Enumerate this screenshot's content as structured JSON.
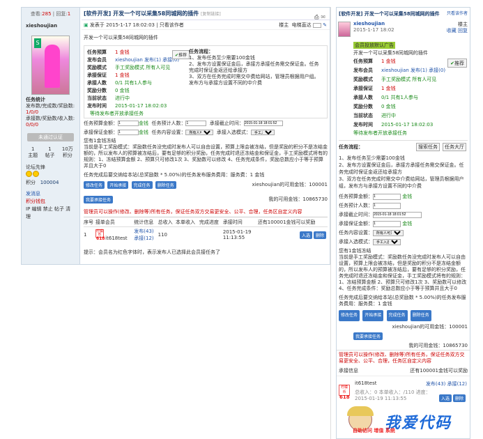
{
  "left": {
    "counts": {
      "views_label": "查看:",
      "views": "285",
      "replies_label": "回复:",
      "replies": "1"
    },
    "title": "[软件开发] 开发一个可以采集58同城网的插件",
    "copy_link": "[复制链接]",
    "meta": {
      "posted": "发表于 2015-1-17 18:02:03",
      "only_author": "只看该作者",
      "floor": "楼主",
      "jump": "电梯直达"
    },
    "username": "xieshoujian",
    "user_info": [
      "任务统计",
      "发布数/完成数/奖励数:",
      "1/0/0",
      "承接数/奖励数/收入数:",
      "0/0/0"
    ],
    "uncertified": "未通过认证",
    "stats": [
      {
        "v": "1",
        "l": "主题"
      },
      {
        "v": "1",
        "l": "帖子"
      },
      {
        "v": "10万",
        "l": "积分"
      }
    ],
    "medal_label": "论坛先锋",
    "points": {
      "label": "积分",
      "value": "100004"
    },
    "links": [
      "发消息",
      "积分钱包",
      "IP 编辑 禁止 帖子 清理"
    ],
    "intro": "开发一个可以采集58同城网的插件",
    "task": {
      "budget_l": "任务预算",
      "budget": "1 金钱",
      "poster_l": "发布会员",
      "poster": "xieshoujian 发布(1) 承接(0)",
      "reward_l": "奖励模式",
      "reward": "手工奖励模式 所有人可见",
      "guarantee_l": "承接保证",
      "guarantee": "1 金钱",
      "takers_l": "承接人数",
      "takers": "0/1 共有1人参与",
      "shares_l": "奖励分数",
      "shares": "0 金钱",
      "status_l": "当前状态",
      "status": "进行中",
      "time_l": "发布时间",
      "time": "2015-01-17 18:02:03",
      "waiting": "等待发布者开放承接任务",
      "recommend": "推荐"
    },
    "flow": {
      "title": "任务流程：",
      "lines": [
        "1、发布任务至少需要100金钱",
        "2、发布方设置保证金后，承接方承接任务需交保证金。任务完成时保证金返还给承接方",
        "3、双方在任务完成时需交中费给网站，管理员根据用户组。发布方与承接方设置不同的中介费"
      ]
    },
    "form": {
      "r1": [
        "任务预算金额：",
        "1",
        "金钱",
        "任务预计人数：",
        "1",
        "承接截止时间：",
        "2015-01-18 18:01:52"
      ],
      "r2": [
        "承接保证金额：",
        "1",
        "金钱",
        "任务内容设置：",
        "所有人可见",
        "承接入选模式：",
        "手工入选"
      ]
    },
    "notes": [
      "您有1金钱冻结",
      "当前是手工奖励模式：奖励数任务没完成时发布人可以自由设置，预算上限会被冻结，但是奖励的积分不是冻结金额的，所以发布人的预算被冻结后，要有足够的积分奖励，任务完成时退还冻结金和保证金，手工奖励模式将有的规则：1、冻结预算金额 2、预算只可修改1次 3、奖励数可以修改 4、任务完成条件，奖励总数应小于等于预算并且大于0"
    ],
    "pay_note": "任务完成后要交纳给本站(总奖励数 * 5.00%)的任务发布服务费用：服务费：1 金钱",
    "buttons": [
      "修改任务",
      "开始承接",
      "完成任务",
      "删除任务"
    ],
    "balance_user": "xieshoujian的可用金钱：100001",
    "accept_btn": "我要承接任务",
    "my_balance": "我的可用金钱：10865730",
    "warning": "管理员可以操作(修改、删除等)所有任务，保证任务双方交易更安全、公平、合理，任务区自定义内容",
    "table": {
      "headers": [
        "序号",
        "接单会员",
        "统计信息",
        "总收入",
        "本单收入",
        "完成进度",
        "承接时间",
        "还有100001金钱可以奖励"
      ],
      "row": {
        "no": "1",
        "uid_a": "柠檬币",
        "uid_b": "618",
        "name": "it618test",
        "stat1": "发布(43)",
        "stat2": "承接(12)",
        "total": "110",
        "this": "",
        "progress": "",
        "time": "2015-01-19 11:13:55",
        "in": "入选",
        "del": "删除"
      }
    },
    "hint": "提示：会员名为红色字体时，表示发布人已选择此会员接任务了"
  },
  "right": {
    "title": "[软件开发] 开发一个可以采集58同城网的插件",
    "only_author": "只看该作者",
    "floor": "楼主",
    "fav": "收藏",
    "reply": "回复",
    "username": "xieshoujian",
    "date": "2015-1-17 18:02",
    "ad": "会员投放默认广告",
    "intro": "开发一个可以采集58同城网的插件",
    "task": {
      "budget_l": "任务预算",
      "budget": "1 金钱",
      "poster_l": "发布会员",
      "poster": "xieshoujian 发布(1) 承接(0)",
      "reward_l": "奖励模式",
      "reward": "手工奖励模式 所有人可见",
      "guarantee_l": "承接保证",
      "guarantee": "1 金钱",
      "takers_l": "承接人数",
      "takers": "0/1 共有1人参与",
      "shares_l": "奖励分数",
      "shares": "0 金钱",
      "status_l": "当前状态",
      "status": "进行中",
      "time_l": "发布时间",
      "time": "2015-01-17 18:02:03",
      "recommend": "推荐",
      "waiting": "等待发布者开放承接任务"
    },
    "flow_title": "任务流程：",
    "flow_b1": "搜索任务",
    "flow_b2": "任务大厅",
    "flow": [
      "1、发布任务至少需要100金钱",
      "2、发布方设置保证金后，承接方承接任务需交保证金。任务完成时保证金返还给承接方",
      "3、双方在任务完成时需交中介费给网站，管理员根据用户组，发布方与承接方设置不同的中介费"
    ],
    "form": [
      [
        "任务预算金额：",
        "1",
        "金钱"
      ],
      [
        "任务预计人数：",
        "1",
        ""
      ],
      [
        "承接截止时间：",
        "2015-01-18 18:01:52",
        ""
      ],
      [
        "承接保证金额：",
        "1",
        "金钱"
      ],
      [
        "任务内容设置：",
        "所有人可见",
        ""
      ],
      [
        "承接入选模式：",
        "手工入选",
        ""
      ]
    ],
    "notes": [
      "您有1金钱冻结",
      "当前是手工奖励模式：奖励数任务没完成时发布人可以自由设置，预算上限会被冻结，但是奖励的积分不是冻结金额的，所以发布人的预算被冻结后，要有足够的积分奖励，任务完成时退还冻结金和保证金，手工奖励模式将有的规则：1、冻结预算金额 2、预算只可修改1次 3、奖励数可以修改 4、任务完成条件：奖励总数应小于等于预算并且大于0"
    ],
    "pay_note": "任务完成后要交纳给本站(总奖励数 * 5.00%)的任务发布服务费用：服务费：1 金钱",
    "buttons": [
      "修改任务",
      "开始承接",
      "完成任务",
      "删除任务"
    ],
    "balance_user": "xieshoujian的可用金钱：100001",
    "accept_btn": "我要承接任务",
    "my_balance": "我的可用金钱：10865730",
    "warning": "管理员可以操作(修改、删除等)所有任务，保证任务双方交易更安全、公平、合理，任务区自定义内容",
    "list_header": "承接信息",
    "list_header2": "还有100001金钱可以奖励",
    "row": {
      "uid_a": "柠檬币",
      "uid_b": "618",
      "name": "it618test",
      "stats": "发布(43) 承接(12)",
      "detail": "总收入：0 本单收入：/110 进度：",
      "time": "2015-01-19 11:13:55",
      "in": "入选",
      "del": "删除"
    }
  },
  "watermark": {
    "text": "我爱代码",
    "sub": "自助访问 增值 系统"
  }
}
